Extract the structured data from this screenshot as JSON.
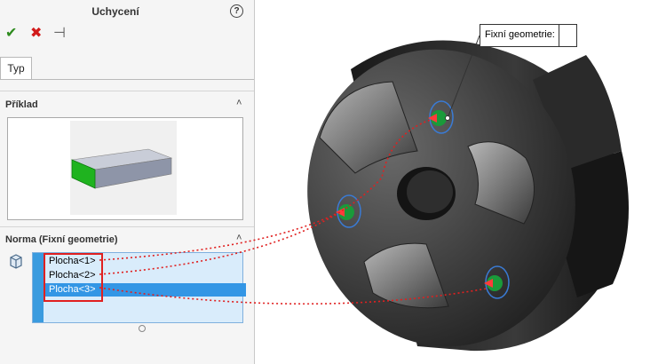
{
  "panel": {
    "title": "Uchycení",
    "help_label": "?",
    "ok_glyph": "✔",
    "cancel_glyph": "✖",
    "pin_glyph": "⊣",
    "tab_label": "Typ",
    "example_section": "Příklad",
    "normal_section": "Norma (Fixní geometrie)",
    "faces": [
      "Plocha<1>",
      "Plocha<2>",
      "Plocha<3>"
    ],
    "selected_face_index": 2
  },
  "viewport": {
    "callout_label": "Fixní geometrie:"
  },
  "colors": {
    "ok": "#2e8b1e",
    "cancel": "#d11a1a",
    "selection": "#3396e5",
    "highlight": "#e02020",
    "fixture": "#1a9a3a"
  },
  "icons": [
    "check-icon",
    "close-icon",
    "pin-icon",
    "help-icon",
    "collapse-chevron-icon",
    "face-selection-icon",
    "fixture-icon"
  ]
}
